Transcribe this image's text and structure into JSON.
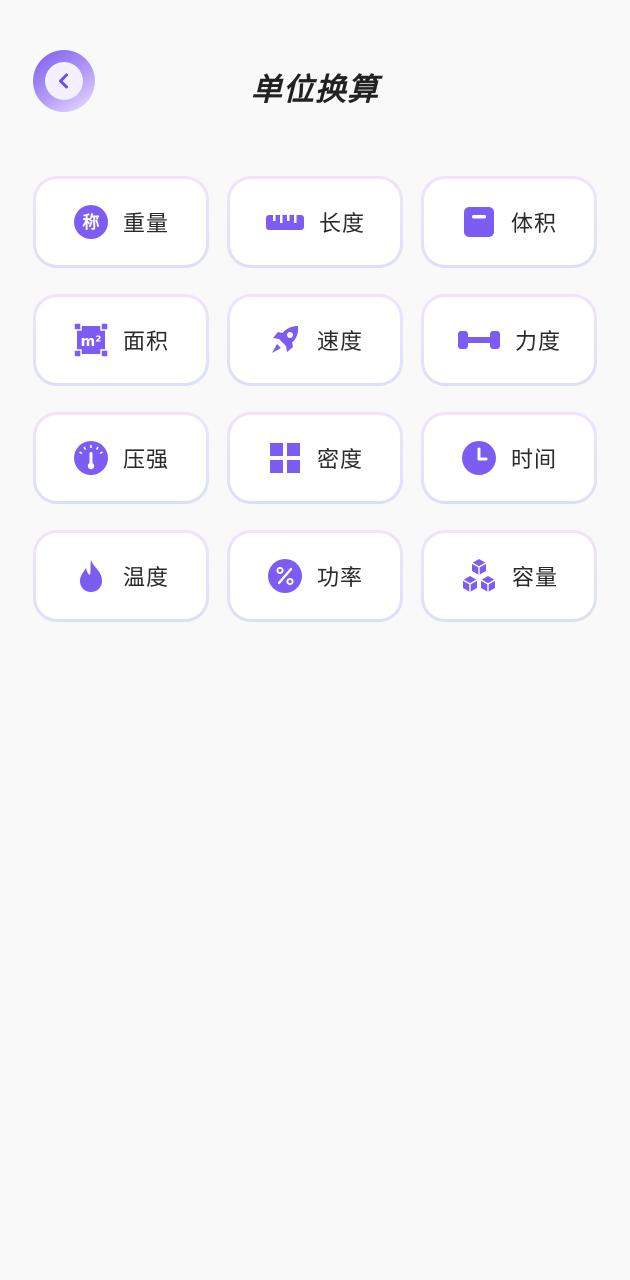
{
  "header": {
    "title": "单位换算",
    "back_icon": "chevron-left-icon"
  },
  "colors": {
    "accent": "#7c5cf2",
    "background": "#f9f9f9"
  },
  "units": [
    {
      "label": "重量",
      "icon": "scale-weight-icon",
      "icon_text": "称"
    },
    {
      "label": "长度",
      "icon": "ruler-icon"
    },
    {
      "label": "体积",
      "icon": "volume-box-icon"
    },
    {
      "label": "面积",
      "icon": "area-square-icon",
      "icon_text": "m²"
    },
    {
      "label": "速度",
      "icon": "rocket-icon"
    },
    {
      "label": "力度",
      "icon": "dumbbell-icon"
    },
    {
      "label": "压强",
      "icon": "pressure-gauge-icon"
    },
    {
      "label": "密度",
      "icon": "grid-blocks-icon"
    },
    {
      "label": "时间",
      "icon": "clock-icon"
    },
    {
      "label": "温度",
      "icon": "flame-icon"
    },
    {
      "label": "功率",
      "icon": "percent-icon"
    },
    {
      "label": "容量",
      "icon": "stacked-cubes-icon"
    }
  ]
}
